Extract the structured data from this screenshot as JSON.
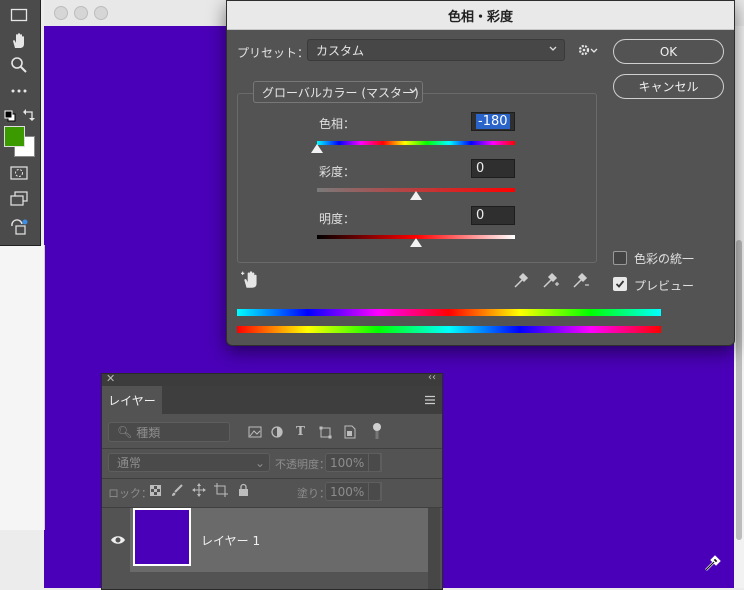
{
  "dialog": {
    "title": "色相・彩度",
    "preset_label": "プリセット：",
    "preset_value": "カスタム",
    "ok_label": "OK",
    "cancel_label": "キャンセル",
    "channel_value": "グローバルカラー (マスター)",
    "hue_label": "色相：",
    "hue_value": "-180",
    "hue_slider_fraction": 0.0,
    "saturation_label": "彩度：",
    "saturation_value": "0",
    "saturation_slider_fraction": 0.5,
    "lightness_label": "明度：",
    "lightness_value": "0",
    "lightness_slider_fraction": 0.5,
    "colorize_label": "色彩の統一",
    "colorize_checked": false,
    "preview_label": "プレビュー",
    "preview_checked": true
  },
  "layers_panel": {
    "tab_label": "レイヤー",
    "filter_value": "種類",
    "blend_mode": "通常",
    "opacity_label": "不透明度：",
    "opacity_value": "100%",
    "lock_label": "ロック：",
    "fill_label": "塗り：",
    "fill_value": "100%",
    "layers": [
      {
        "name": "レイヤー 1",
        "visible": true
      }
    ]
  },
  "colors": {
    "canvas": "#4a00b8",
    "foreground": "#3a9a00",
    "background": "#ffffff"
  },
  "toolbar": {
    "tools": [
      "rectangle-marquee-icon",
      "hand-icon",
      "zoom-icon",
      "more-tools-icon",
      "default-colors-icon",
      "swap-colors-icon",
      "quick-mask-icon",
      "screen-mode-icon",
      "content-aware-icon"
    ]
  }
}
